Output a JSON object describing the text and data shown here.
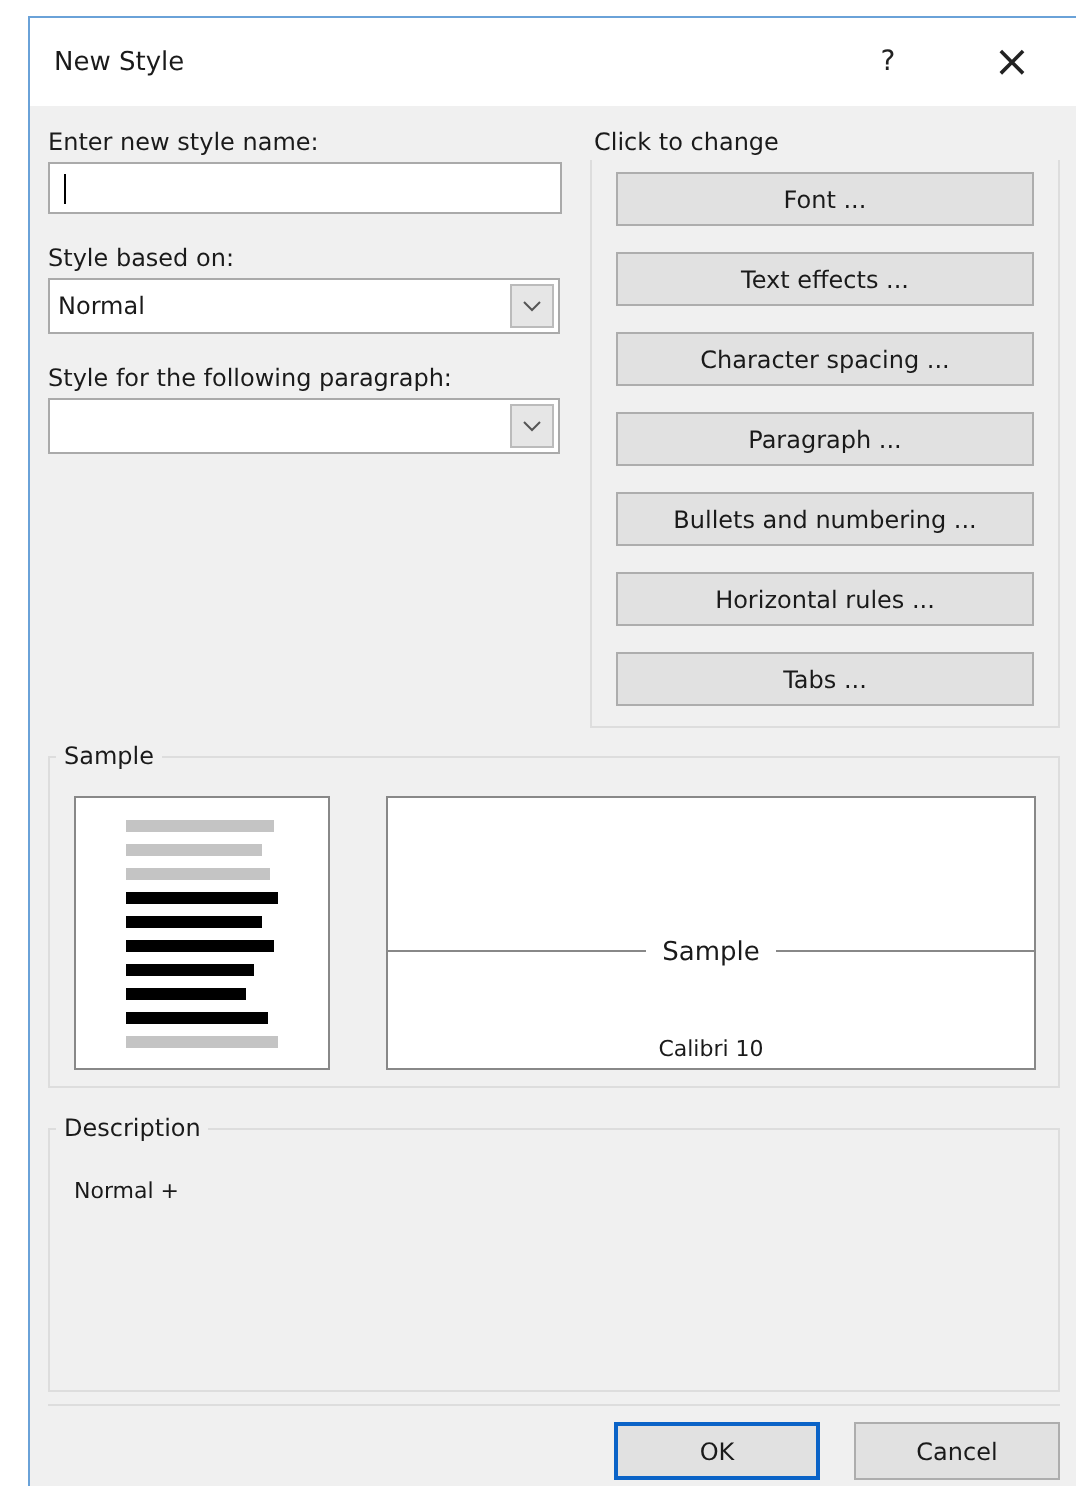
{
  "window": {
    "title": "New Style",
    "help": "?",
    "close": "×"
  },
  "name_field": {
    "label": "Enter new style name:",
    "focused": true
  },
  "based_on": {
    "label": "Style based on:",
    "value": "Normal"
  },
  "following": {
    "label": "Style for the following paragraph:"
  },
  "click_to_change": {
    "label": "Click to change",
    "buttons": [
      "Font ...",
      "Text effects ...",
      "Character spacing ...",
      "Paragraph ...",
      "Bullets and numbering ...",
      "Horizontal rules ...",
      "Tabs ..."
    ]
  },
  "sample": {
    "label": "Sample",
    "preview_text": "Sample",
    "font_caption": "Calibri 10"
  },
  "description": {
    "label": "Description",
    "text": "Normal +"
  },
  "buttons": [
    {
      "label": "OK",
      "default": true
    },
    {
      "label": "Cancel",
      "default": false
    }
  ]
}
